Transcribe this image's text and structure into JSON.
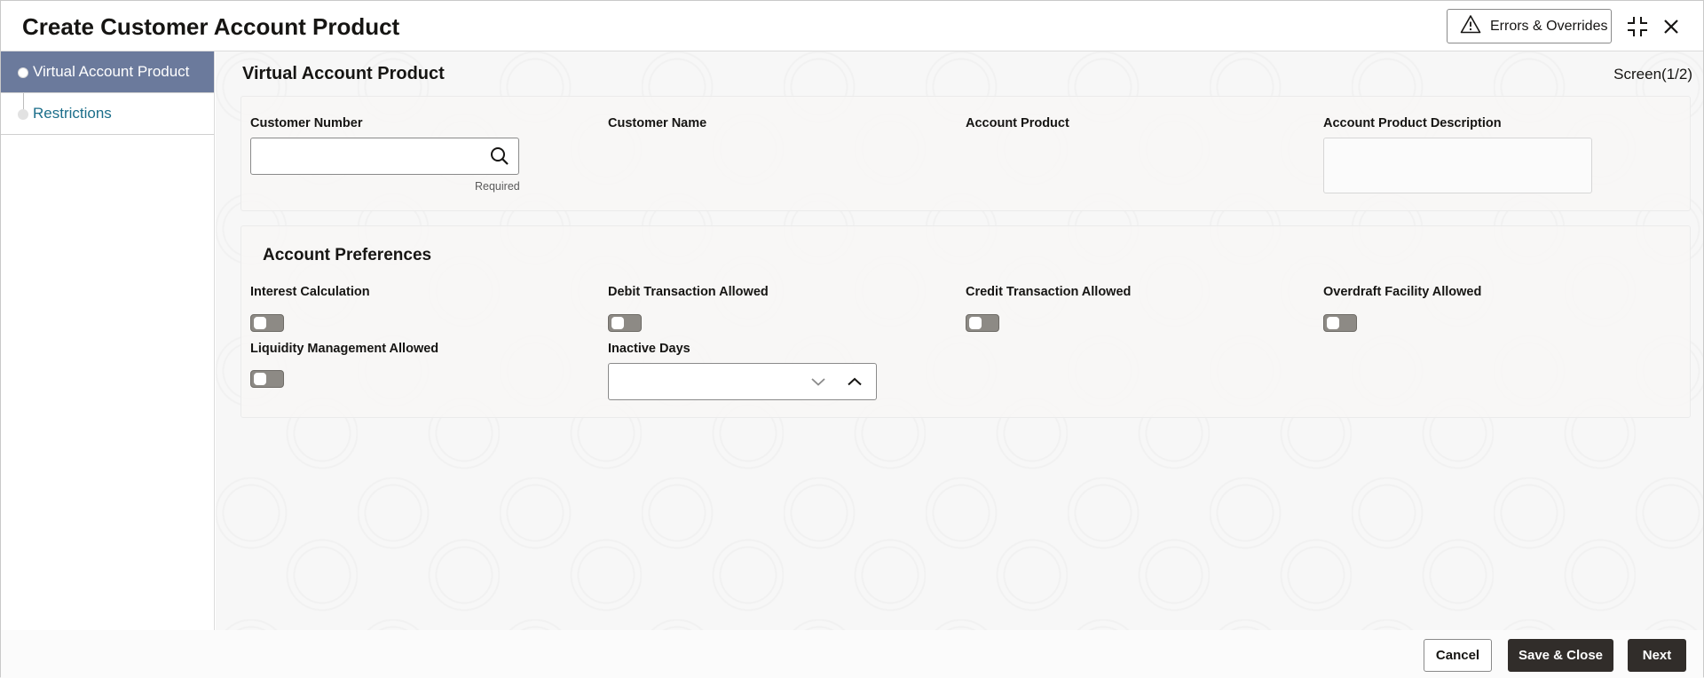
{
  "window": {
    "title": "Create Customer Account Product",
    "errors_overrides_label": "Errors & Overrides",
    "icons": [
      "warning-icon",
      "collapse-icon",
      "close-icon"
    ]
  },
  "sidebar": {
    "items": [
      {
        "label": "Virtual Account Product",
        "active": true
      },
      {
        "label": "Restrictions",
        "active": false
      }
    ]
  },
  "main": {
    "section_title": "Virtual Account Product",
    "screen_indicator": "Screen(1/2)",
    "customer": {
      "customer_number_label": "Customer Number",
      "customer_number_value": "",
      "customer_number_helper": "Required",
      "customer_name_label": "Customer Name",
      "account_product_label": "Account Product",
      "account_product_description_label": "Account Product Description",
      "account_product_description_value": ""
    },
    "preferences": {
      "title": "Account Preferences",
      "interest_calculation_label": "Interest Calculation",
      "interest_calculation_on": false,
      "debit_transaction_label": "Debit Transaction Allowed",
      "debit_transaction_on": false,
      "credit_transaction_label": "Credit Transaction Allowed",
      "credit_transaction_on": false,
      "overdraft_facility_label": "Overdraft Facility Allowed",
      "overdraft_facility_on": false,
      "liquidity_management_label": "Liquidity Management Allowed",
      "liquidity_management_on": false,
      "inactive_days_label": "Inactive Days",
      "inactive_days_value": ""
    }
  },
  "footer": {
    "cancel_label": "Cancel",
    "save_close_label": "Save & Close",
    "next_label": "Next"
  },
  "colors": {
    "nav_active_bg": "#6b7a9c",
    "nav_link": "#1b6e8a",
    "primary_button": "#312d2a",
    "toggle_off": "#8d8a85"
  }
}
